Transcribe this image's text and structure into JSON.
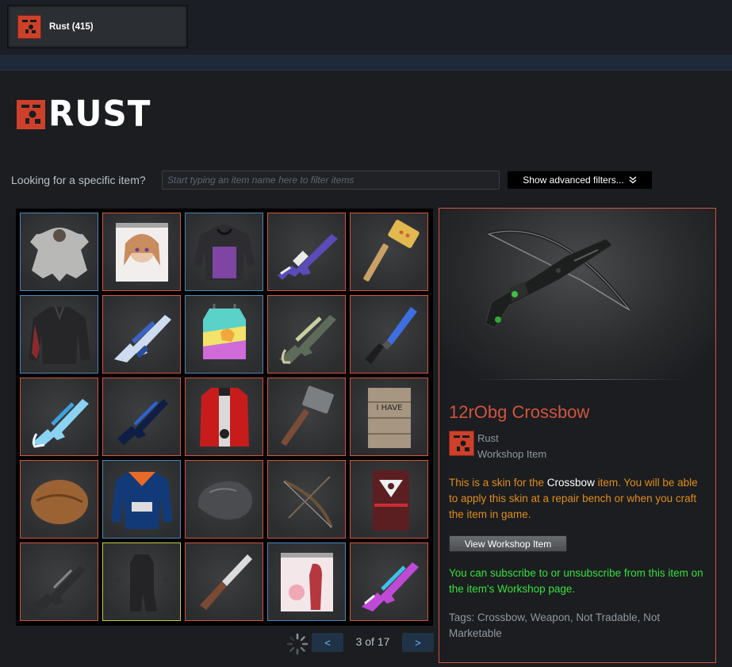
{
  "app_tab": {
    "label": "Rust (415)",
    "icon": "rust-logo-icon"
  },
  "brand": {
    "wordmark": "RUST",
    "color": "#cd412b"
  },
  "search": {
    "label": "Looking for a specific item?",
    "placeholder": "Start typing an item name here to filter items",
    "value": "",
    "advanced_label": "Show advanced filters..."
  },
  "grid": {
    "slots": [
      {
        "icon": "bear-rug-icon",
        "border": "blue"
      },
      {
        "icon": "anime-garage-door-icon",
        "border": "red"
      },
      {
        "icon": "purple-hoodie-icon",
        "border": "blue"
      },
      {
        "icon": "purple-assault-rifle-icon",
        "border": "red"
      },
      {
        "icon": "wooden-hammer-icon",
        "border": "red"
      },
      {
        "icon": "black-shirt-icon",
        "border": "blue"
      },
      {
        "icon": "blue-smg-icon",
        "border": "red"
      },
      {
        "icon": "rainbow-chestplate-icon",
        "border": "blue"
      },
      {
        "icon": "camo-smg-icon",
        "border": "red"
      },
      {
        "icon": "blue-knife-icon",
        "border": "red"
      },
      {
        "icon": "ice-smg-icon",
        "border": "red"
      },
      {
        "icon": "dark-blue-rifle-icon",
        "border": "red"
      },
      {
        "icon": "red-jacket-icon",
        "border": "red"
      },
      {
        "icon": "sledgehammer-icon",
        "border": "red"
      },
      {
        "icon": "wooden-door-icon",
        "border": "red"
      },
      {
        "icon": "brown-nut-icon",
        "border": "red"
      },
      {
        "icon": "racing-jacket-icon",
        "border": "blue"
      },
      {
        "icon": "stone-icon",
        "border": "red"
      },
      {
        "icon": "bow-icon",
        "border": "red"
      },
      {
        "icon": "red-door-icon",
        "border": "red"
      },
      {
        "icon": "black-rifle-icon",
        "border": "red"
      },
      {
        "icon": "black-outfit-icon",
        "border": "yellow"
      },
      {
        "icon": "bone-knife-icon",
        "border": "red"
      },
      {
        "icon": "pink-garage-door-icon",
        "border": "blue"
      },
      {
        "icon": "neon-rifle-icon",
        "border": "red"
      }
    ]
  },
  "pager": {
    "prev": "<",
    "next": ">",
    "current": 3,
    "total": 17,
    "text": "3 of 17"
  },
  "details": {
    "name": "12rObg Crossbow",
    "game": "Rust",
    "type": "Workshop Item",
    "desc_prefix": "This is a skin for the ",
    "desc_item": "Crossbow",
    "desc_suffix": " item. You will be able to apply this skin at a repair bench or when you craft the item in game.",
    "view_button": "View Workshop Item",
    "subscribe_note": "You can subscribe to or unsubscribe from this item on the item's Workshop page.",
    "tags": "Tags: Crossbow, Weapon, Not Tradable, Not Marketable",
    "name_color": "#d2543f",
    "desc_color": "#e08c18",
    "note_color": "#36e03c"
  }
}
